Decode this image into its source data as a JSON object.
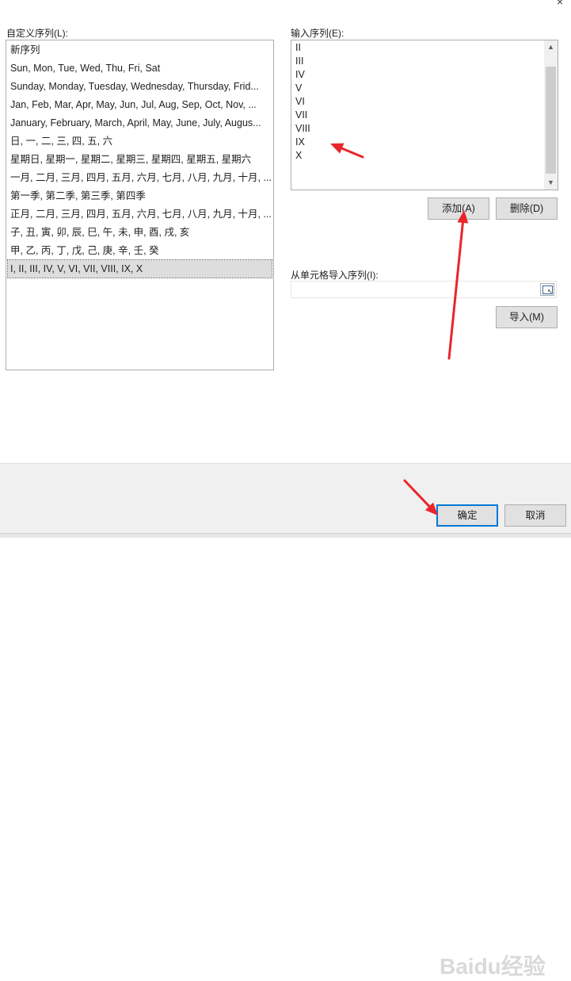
{
  "dialog": {
    "custom_lists_label": "自定义序列(L):",
    "list_entries_label": "输入序列(E):",
    "import_label": "从单元格导入序列(I):",
    "close_glyph": "×"
  },
  "custom_lists": [
    "新序列",
    "Sun, Mon, Tue, Wed, Thu, Fri, Sat",
    "Sunday, Monday, Tuesday, Wednesday, Thursday, Frid...",
    "Jan, Feb, Mar, Apr, May, Jun, Jul, Aug, Sep, Oct, Nov, ...",
    "January, February, March, April, May, June, July, Augus...",
    "日, 一, 二, 三, 四, 五, 六",
    "星期日, 星期一, 星期二, 星期三, 星期四, 星期五, 星期六",
    "一月, 二月, 三月, 四月, 五月, 六月, 七月, 八月, 九月, 十月, ...",
    "第一季, 第二季, 第三季, 第四季",
    "正月, 二月, 三月, 四月, 五月, 六月, 七月, 八月, 九月, 十月, ...",
    "子, 丑, 寅, 卯, 辰, 巳, 午, 未, 申, 酉, 戌, 亥",
    "甲, 乙, 丙, 丁, 戊, 己, 庚, 辛, 壬, 癸",
    "I, II, III, IV, V, VI, VII, VIII, IX, X"
  ],
  "selected_index": 12,
  "list_entries": [
    "II",
    "III",
    "IV",
    "V",
    "VI",
    "VII",
    "VIII",
    "IX",
    "X"
  ],
  "buttons": {
    "add": "添加(A)",
    "delete": "删除(D)",
    "import": "导入(M)",
    "ok": "确定",
    "cancel": "取消"
  },
  "import_field_value": "",
  "watermark": "Baidu经验",
  "colors": {
    "annotation_arrow": "#e8262b",
    "default_button_border": "#0078d7",
    "selection": "#dddddd"
  }
}
